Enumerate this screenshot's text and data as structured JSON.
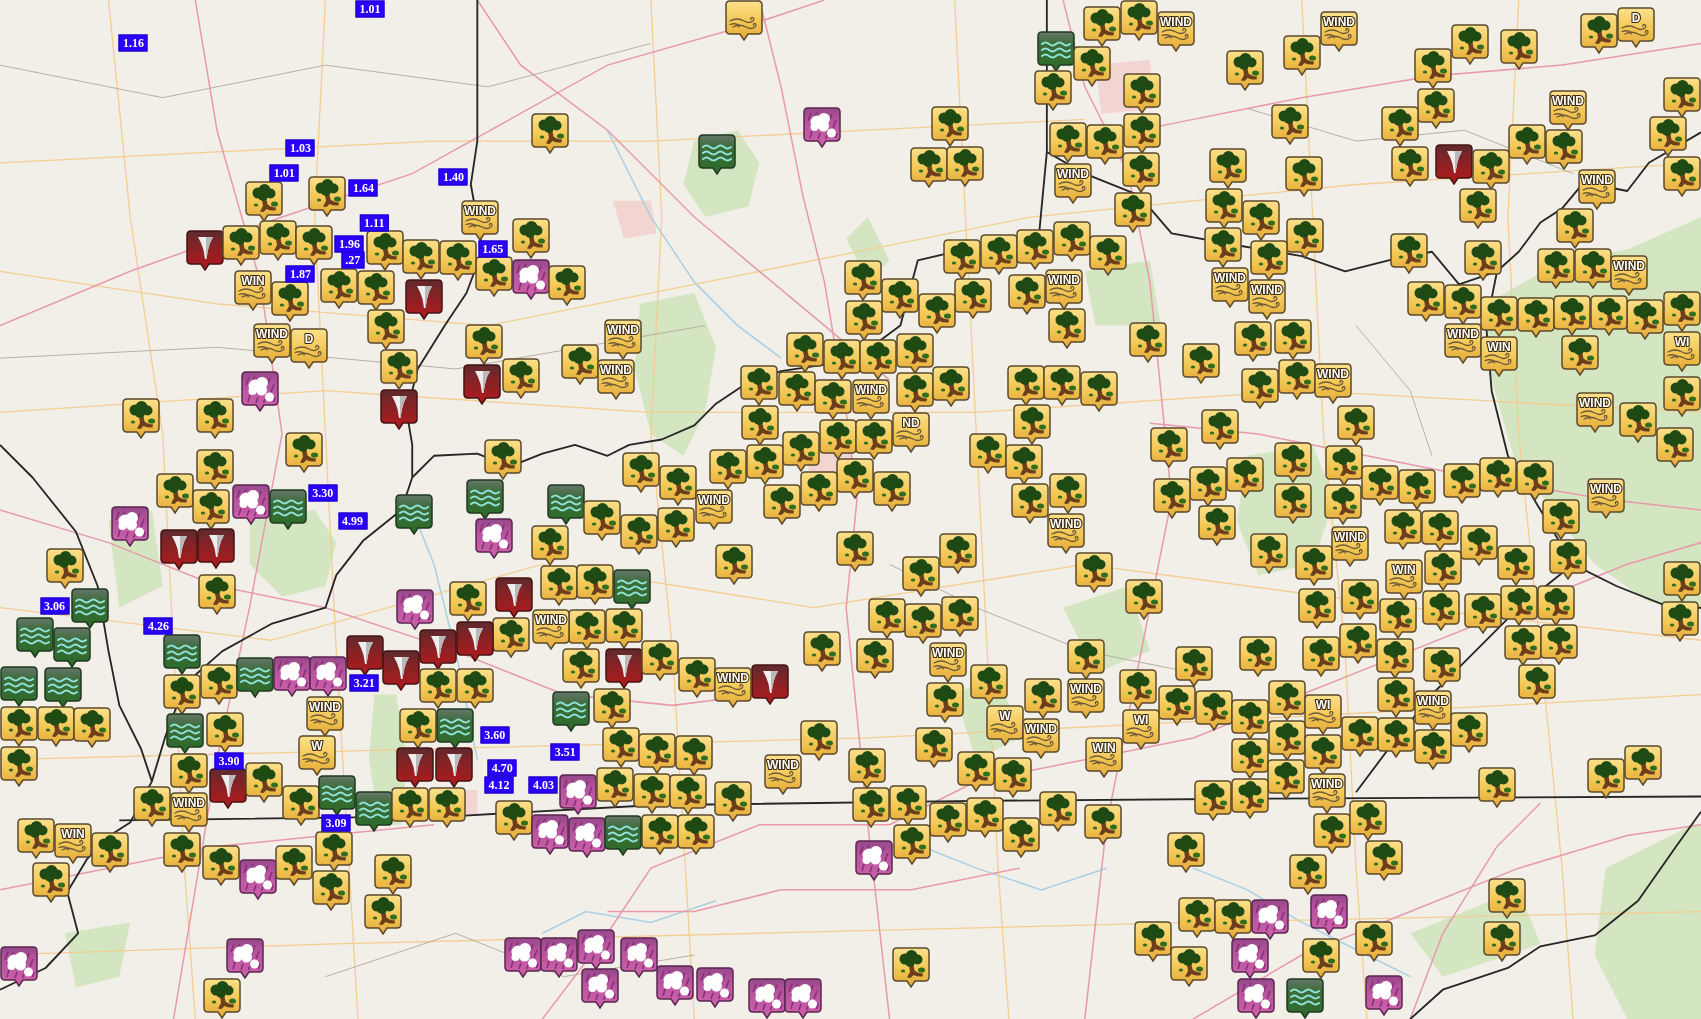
{
  "map": {
    "markers": [
      {
        "kind": "tree"
      },
      {
        "kind": "tree"
      },
      {
        "kind": "tree"
      },
      {
        "kind": "tree"
      },
      {
        "kind": "tornado"
      },
      {
        "kind": "tree"
      },
      {
        "kind": "tree"
      },
      {
        "kind": "tree"
      },
      {
        "kind": "tree"
      },
      {
        "kind": "tornado"
      },
      {
        "kind": "tree"
      },
      {
        "kind": "tree"
      },
      {
        "kind": "tree"
      },
      {
        "kind": "tree"
      },
      {
        "kind": "tree"
      },
      {
        "kind": "wind",
        "label": "WIN"
      },
      {
        "kind": "wind",
        "label": "WIND"
      },
      {
        "kind": "tree"
      },
      {
        "kind": "hail"
      },
      {
        "kind": "tree"
      },
      {
        "kind": "wind",
        "label": "D"
      },
      {
        "kind": "wind",
        "label": "WIND"
      },
      {
        "kind": "tree"
      },
      {
        "kind": "tree"
      },
      {
        "kind": "hail"
      },
      {
        "kind": "tornado"
      },
      {
        "kind": "tornado"
      },
      {
        "kind": "tree"
      },
      {
        "kind": "tree"
      },
      {
        "kind": "tree"
      },
      {
        "kind": "tree"
      },
      {
        "kind": "tree"
      },
      {
        "kind": "tree"
      },
      {
        "kind": "tree"
      },
      {
        "kind": "tree"
      },
      {
        "kind": "tree"
      },
      {
        "kind": "wind"
      },
      {
        "kind": "flood"
      },
      {
        "kind": "tree"
      },
      {
        "kind": "tree"
      },
      {
        "kind": "tree"
      },
      {
        "kind": "hail"
      },
      {
        "kind": "flood"
      },
      {
        "kind": "tree"
      },
      {
        "kind": "tree"
      },
      {
        "kind": "tree"
      },
      {
        "kind": "tree"
      },
      {
        "kind": "tree"
      },
      {
        "kind": "tree"
      },
      {
        "kind": "tree"
      },
      {
        "kind": "wind",
        "label": "WIND"
      },
      {
        "kind": "tree"
      },
      {
        "kind": "tree"
      },
      {
        "kind": "tree"
      },
      {
        "kind": "tree"
      },
      {
        "kind": "tree"
      },
      {
        "kind": "tree"
      },
      {
        "kind": "tree"
      },
      {
        "kind": "wind",
        "label": "WIND"
      },
      {
        "kind": "tree"
      },
      {
        "kind": "tree"
      },
      {
        "kind": "tree"
      },
      {
        "kind": "tree"
      },
      {
        "kind": "tree"
      },
      {
        "kind": "tree"
      },
      {
        "kind": "wind",
        "label": "WIND"
      },
      {
        "kind": "wind",
        "label": "WIND"
      },
      {
        "kind": "tree"
      },
      {
        "kind": "tree"
      },
      {
        "kind": "tree"
      },
      {
        "kind": "tree"
      },
      {
        "kind": "tree"
      },
      {
        "kind": "tree"
      },
      {
        "kind": "tree"
      },
      {
        "kind": "tree"
      },
      {
        "kind": "wind",
        "label": "WIND"
      },
      {
        "kind": "tree"
      },
      {
        "kind": "tree"
      },
      {
        "kind": "tree"
      },
      {
        "kind": "wind",
        "label": "ND"
      },
      {
        "kind": "tree"
      },
      {
        "kind": "tree"
      },
      {
        "kind": "tree"
      },
      {
        "kind": "tree"
      },
      {
        "kind": "tree"
      },
      {
        "kind": "tree"
      },
      {
        "kind": "tree"
      },
      {
        "kind": "tree"
      },
      {
        "kind": "tree"
      },
      {
        "kind": "tree"
      },
      {
        "kind": "tree"
      },
      {
        "kind": "tree"
      },
      {
        "kind": "tree"
      },
      {
        "kind": "tree"
      },
      {
        "kind": "tree"
      },
      {
        "kind": "tree"
      },
      {
        "kind": "tree"
      },
      {
        "kind": "tree"
      },
      {
        "kind": "tree"
      },
      {
        "kind": "wind",
        "label": "WIND"
      },
      {
        "kind": "tree"
      },
      {
        "kind": "wind",
        "label": "WIND"
      },
      {
        "kind": "tree"
      },
      {
        "kind": "tree"
      },
      {
        "kind": "tree"
      },
      {
        "kind": "tree"
      },
      {
        "kind": "tree"
      },
      {
        "kind": "tree"
      },
      {
        "kind": "tree"
      },
      {
        "kind": "tree"
      },
      {
        "kind": "wind",
        "label": "D"
      },
      {
        "kind": "tree"
      },
      {
        "kind": "tree"
      },
      {
        "kind": "tree"
      },
      {
        "kind": "wind",
        "label": "WIND"
      },
      {
        "kind": "tree"
      },
      {
        "kind": "tree"
      },
      {
        "kind": "tree"
      },
      {
        "kind": "tornado"
      },
      {
        "kind": "tree"
      },
      {
        "kind": "tree"
      },
      {
        "kind": "wind",
        "label": "WIND"
      },
      {
        "kind": "tree"
      },
      {
        "kind": "tree"
      },
      {
        "kind": "tree"
      },
      {
        "kind": "wind",
        "label": "WIND"
      },
      {
        "kind": "tree"
      },
      {
        "kind": "tree"
      },
      {
        "kind": "tree"
      },
      {
        "kind": "wind",
        "label": "WI"
      },
      {
        "kind": "tree"
      },
      {
        "kind": "wind",
        "label": "WIND"
      },
      {
        "kind": "tree"
      },
      {
        "kind": "tree"
      },
      {
        "kind": "tree"
      },
      {
        "kind": "tree"
      },
      {
        "kind": "tree"
      },
      {
        "kind": "tree"
      },
      {
        "kind": "tree"
      },
      {
        "kind": "tree"
      },
      {
        "kind": "tree"
      },
      {
        "kind": "tree"
      },
      {
        "kind": "tree"
      },
      {
        "kind": "wind",
        "label": "WIND"
      },
      {
        "kind": "wind",
        "label": "WIND"
      },
      {
        "kind": "tree"
      },
      {
        "kind": "tree"
      },
      {
        "kind": "tree"
      },
      {
        "kind": "tree"
      },
      {
        "kind": "wind",
        "label": "WIND"
      },
      {
        "kind": "tree"
      },
      {
        "kind": "tree"
      },
      {
        "kind": "tree"
      },
      {
        "kind": "tree"
      },
      {
        "kind": "tree"
      },
      {
        "kind": "tree"
      },
      {
        "kind": "tree"
      },
      {
        "kind": "tree"
      },
      {
        "kind": "tree"
      },
      {
        "kind": "tree"
      },
      {
        "kind": "wind",
        "label": "WIND"
      },
      {
        "kind": "wind",
        "label": "WIN"
      },
      {
        "kind": "tree"
      },
      {
        "kind": "tree"
      },
      {
        "kind": "tree"
      },
      {
        "kind": "tree"
      },
      {
        "kind": "tree"
      },
      {
        "kind": "tree"
      },
      {
        "kind": "tree"
      },
      {
        "kind": "tree"
      },
      {
        "kind": "tree"
      },
      {
        "kind": "tree"
      },
      {
        "kind": "tree"
      },
      {
        "kind": "tree"
      },
      {
        "kind": "tree"
      },
      {
        "kind": "tree"
      },
      {
        "kind": "wind",
        "label": "WIND"
      },
      {
        "kind": "tree"
      },
      {
        "kind": "hail"
      },
      {
        "kind": "hail"
      },
      {
        "kind": "flood"
      },
      {
        "kind": "flood"
      },
      {
        "kind": "flood"
      },
      {
        "kind": "hail"
      },
      {
        "kind": "flood"
      },
      {
        "kind": "tree"
      },
      {
        "kind": "tornado"
      },
      {
        "kind": "tornado"
      },
      {
        "kind": "tree"
      },
      {
        "kind": "tree"
      },
      {
        "kind": "flood"
      },
      {
        "kind": "flood"
      },
      {
        "kind": "flood"
      },
      {
        "kind": "flood"
      },
      {
        "kind": "flood"
      },
      {
        "kind": "tree"
      },
      {
        "kind": "tree"
      },
      {
        "kind": "tree"
      },
      {
        "kind": "tree"
      },
      {
        "kind": "tree"
      },
      {
        "kind": "tree"
      },
      {
        "kind": "tornado"
      },
      {
        "kind": "tree"
      },
      {
        "kind": "wind",
        "label": "WIND"
      },
      {
        "kind": "tornado"
      },
      {
        "kind": "tornado"
      },
      {
        "kind": "hail"
      },
      {
        "kind": "tornado"
      },
      {
        "kind": "tornado"
      },
      {
        "kind": "tree"
      },
      {
        "kind": "flood"
      },
      {
        "kind": "tree"
      },
      {
        "kind": "tree"
      },
      {
        "kind": "flood"
      },
      {
        "kind": "hail"
      },
      {
        "kind": "hail"
      },
      {
        "kind": "flood"
      },
      {
        "kind": "tree"
      },
      {
        "kind": "tree"
      },
      {
        "kind": "wind",
        "label": "WIND"
      },
      {
        "kind": "tornado"
      },
      {
        "kind": "tree"
      },
      {
        "kind": "wind",
        "label": "W"
      },
      {
        "kind": "tree"
      },
      {
        "kind": "flood"
      },
      {
        "kind": "flood"
      },
      {
        "kind": "tree"
      },
      {
        "kind": "tree"
      },
      {
        "kind": "flood"
      },
      {
        "kind": "tornado"
      },
      {
        "kind": "tornado"
      },
      {
        "kind": "tree"
      },
      {
        "kind": "tree"
      },
      {
        "kind": "tree"
      },
      {
        "kind": "hail"
      },
      {
        "kind": "hail"
      },
      {
        "kind": "hail"
      },
      {
        "kind": "tree"
      },
      {
        "kind": "wind",
        "label": "WIND"
      },
      {
        "kind": "tree"
      },
      {
        "kind": "tree"
      },
      {
        "kind": "wind",
        "label": "WIN"
      },
      {
        "kind": "tree"
      },
      {
        "kind": "tree"
      },
      {
        "kind": "tree"
      },
      {
        "kind": "hail"
      },
      {
        "kind": "tree"
      },
      {
        "kind": "tree"
      },
      {
        "kind": "tree"
      },
      {
        "kind": "tree"
      },
      {
        "kind": "tree"
      },
      {
        "kind": "hail"
      },
      {
        "kind": "hail"
      },
      {
        "kind": "tree"
      },
      {
        "kind": "tree"
      },
      {
        "kind": "tree"
      },
      {
        "kind": "tree"
      },
      {
        "kind": "wind",
        "label": "WIND"
      },
      {
        "kind": "tree"
      },
      {
        "kind": "tree"
      },
      {
        "kind": "tree"
      },
      {
        "kind": "wind",
        "label": "WIND"
      },
      {
        "kind": "tree"
      },
      {
        "kind": "tree"
      },
      {
        "kind": "flood"
      },
      {
        "kind": "tree"
      },
      {
        "kind": "tree"
      },
      {
        "kind": "tornado"
      },
      {
        "kind": "tree"
      },
      {
        "kind": "tree"
      },
      {
        "kind": "flood"
      },
      {
        "kind": "tree"
      },
      {
        "kind": "tree"
      },
      {
        "kind": "tree"
      },
      {
        "kind": "tornado"
      },
      {
        "kind": "wind",
        "label": "WIND"
      },
      {
        "kind": "tree"
      },
      {
        "kind": "tree"
      },
      {
        "kind": "tree"
      },
      {
        "kind": "tree"
      },
      {
        "kind": "tree"
      },
      {
        "kind": "tree"
      },
      {
        "kind": "wind",
        "label": "WIND"
      },
      {
        "kind": "tree"
      },
      {
        "kind": "tree"
      },
      {
        "kind": "tree"
      },
      {
        "kind": "wind",
        "label": "WIND"
      },
      {
        "kind": "tree"
      },
      {
        "kind": "tree"
      },
      {
        "kind": "tree"
      },
      {
        "kind": "tree"
      },
      {
        "kind": "tree"
      },
      {
        "kind": "hail"
      },
      {
        "kind": "tree"
      },
      {
        "kind": "tree"
      },
      {
        "kind": "tree"
      },
      {
        "kind": "tree"
      },
      {
        "kind": "tree"
      },
      {
        "kind": "tree"
      },
      {
        "kind": "tree"
      },
      {
        "kind": "tree"
      },
      {
        "kind": "tree"
      },
      {
        "kind": "wind",
        "label": "W"
      },
      {
        "kind": "wind",
        "label": "WIND"
      },
      {
        "kind": "tree"
      },
      {
        "kind": "wind",
        "label": "WIND"
      },
      {
        "kind": "wind",
        "label": "WIN"
      },
      {
        "kind": "tree"
      },
      {
        "kind": "tree"
      },
      {
        "kind": "tree"
      },
      {
        "kind": "tree"
      },
      {
        "kind": "tree"
      },
      {
        "kind": "tree"
      },
      {
        "kind": "tree"
      },
      {
        "kind": "tree"
      },
      {
        "kind": "flood"
      },
      {
        "kind": "hail"
      },
      {
        "kind": "hail"
      },
      {
        "kind": "hail"
      },
      {
        "kind": "hail"
      },
      {
        "kind": "hail"
      },
      {
        "kind": "hail"
      },
      {
        "kind": "hail"
      },
      {
        "kind": "hail"
      },
      {
        "kind": "hail"
      },
      {
        "kind": "tree"
      },
      {
        "kind": "tree"
      },
      {
        "kind": "tree"
      },
      {
        "kind": "tree"
      },
      {
        "kind": "tree"
      },
      {
        "kind": "tree"
      },
      {
        "kind": "wind",
        "label": "WIND"
      },
      {
        "kind": "tree"
      },
      {
        "kind": "tree"
      },
      {
        "kind": "tree"
      },
      {
        "kind": "tree"
      },
      {
        "kind": "tree"
      },
      {
        "kind": "tree"
      },
      {
        "kind": "tree"
      },
      {
        "kind": "tree"
      },
      {
        "kind": "wind",
        "label": "WIN"
      },
      {
        "kind": "tree"
      },
      {
        "kind": "tree"
      },
      {
        "kind": "tree"
      },
      {
        "kind": "tree"
      },
      {
        "kind": "tree"
      },
      {
        "kind": "tree"
      },
      {
        "kind": "tree"
      },
      {
        "kind": "tree"
      },
      {
        "kind": "tree"
      },
      {
        "kind": "tree"
      },
      {
        "kind": "tree"
      },
      {
        "kind": "tree"
      },
      {
        "kind": "tree"
      },
      {
        "kind": "tree"
      },
      {
        "kind": "tree"
      },
      {
        "kind": "tree"
      },
      {
        "kind": "tree"
      },
      {
        "kind": "tree"
      },
      {
        "kind": "tree"
      },
      {
        "kind": "wind",
        "label": "WI"
      },
      {
        "kind": "tree"
      },
      {
        "kind": "tree"
      },
      {
        "kind": "wind",
        "label": "WI"
      },
      {
        "kind": "tree"
      },
      {
        "kind": "tree"
      },
      {
        "kind": "tree"
      },
      {
        "kind": "wind",
        "label": "WIND"
      },
      {
        "kind": "tree"
      },
      {
        "kind": "tree"
      },
      {
        "kind": "tree"
      },
      {
        "kind": "tree"
      },
      {
        "kind": "tree"
      },
      {
        "kind": "wind",
        "label": "WIND"
      },
      {
        "kind": "tree"
      },
      {
        "kind": "tree"
      },
      {
        "kind": "tree"
      },
      {
        "kind": "tree"
      },
      {
        "kind": "tree"
      },
      {
        "kind": "tree"
      },
      {
        "kind": "tree"
      },
      {
        "kind": "tree"
      },
      {
        "kind": "tree"
      },
      {
        "kind": "tree"
      },
      {
        "kind": "hail"
      },
      {
        "kind": "tree"
      },
      {
        "kind": "tree"
      },
      {
        "kind": "tree"
      },
      {
        "kind": "hail"
      },
      {
        "kind": "tree"
      },
      {
        "kind": "tree"
      },
      {
        "kind": "tree"
      },
      {
        "kind": "hail"
      },
      {
        "kind": "hail"
      },
      {
        "kind": "tree"
      },
      {
        "kind": "tree"
      },
      {
        "kind": "hail"
      },
      {
        "kind": "flood"
      }
    ],
    "rain_totals": [
      "1.01",
      "1.16",
      "1.03",
      "1.01",
      "1.40",
      "1.64",
      "1.11",
      "1.65",
      "1.96",
      ".27",
      "1.87",
      "3.30",
      "4.99",
      "3.06",
      "4.26",
      "3.21",
      "3.60",
      "3.51",
      "3.90",
      "4.70",
      "4.12",
      "4.03",
      "3.09"
    ]
  }
}
